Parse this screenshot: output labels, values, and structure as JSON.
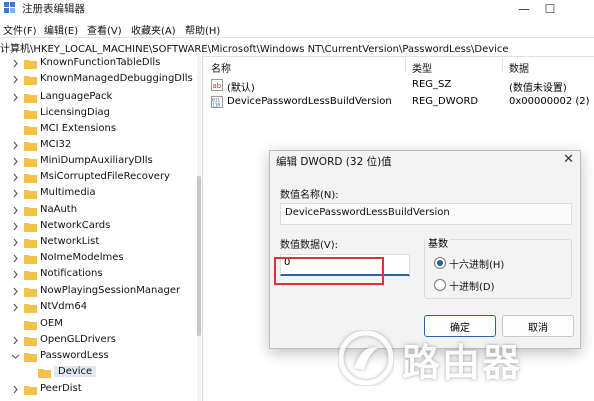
{
  "window": {
    "title": "注册表编辑器",
    "controls": {
      "minimize": "—",
      "maximize": "☐"
    }
  },
  "menu": [
    "文件(F)",
    "编辑(E)",
    "查看(V)",
    "收藏夹(A)",
    "帮助(H)"
  ],
  "address": "计算机\\HKEY_LOCAL_MACHINE\\SOFTWARE\\Microsoft\\Windows NT\\CurrentVersion\\PasswordLess\\Device",
  "tree": {
    "items": [
      {
        "label": "KnownFunctionTableDlls",
        "expanded": false
      },
      {
        "label": "KnownManagedDebuggingDlls",
        "expanded": false
      },
      {
        "label": "LanguagePack",
        "expanded": false
      },
      {
        "label": "LicensingDiag",
        "expanded": false
      },
      {
        "label": "MCI Extensions",
        "expanded": false
      },
      {
        "label": "MCI32",
        "expanded": false
      },
      {
        "label": "MiniDumpAuxiliaryDlls",
        "expanded": false
      },
      {
        "label": "MsiCorruptedFileRecovery",
        "expanded": false
      },
      {
        "label": "Multimedia",
        "expanded": false
      },
      {
        "label": "NaAuth",
        "expanded": false
      },
      {
        "label": "NetworkCards",
        "expanded": false
      },
      {
        "label": "NetworkList",
        "expanded": false
      },
      {
        "label": "NoImeModelmes",
        "expanded": false
      },
      {
        "label": "Notifications",
        "expanded": false
      },
      {
        "label": "NowPlayingSessionManager",
        "expanded": false
      },
      {
        "label": "NtVdm64",
        "expanded": false
      },
      {
        "label": "OEM",
        "expanded": false
      },
      {
        "label": "OpenGLDrivers",
        "expanded": false
      },
      {
        "label": "PasswordLess",
        "expanded": true
      },
      {
        "label": "Device",
        "child": true,
        "selected": true
      },
      {
        "label": "PeerDist",
        "expanded": false
      }
    ]
  },
  "values_pane": {
    "columns": {
      "name": "名称",
      "type": "类型",
      "data": "数据"
    },
    "rows": [
      {
        "icon": "string-value-icon",
        "name": "(默认)",
        "type": "REG_SZ",
        "data": "(数值未设置)"
      },
      {
        "icon": "binary-value-icon",
        "name": "DevicePasswordLessBuildVersion",
        "type": "REG_DWORD",
        "data": "0x00000002 (2)"
      }
    ]
  },
  "dialog": {
    "title": "编辑 DWORD (32 位)值",
    "name_label": "数值名称(N):",
    "name_value": "DevicePasswordLessBuildVersion",
    "data_label": "数值数据(V):",
    "data_value": "0",
    "base_label": "基数",
    "base_options": [
      "十六进制(H)",
      "十进制(D)"
    ],
    "base_selected": "十六进制(H)",
    "ok_label": "确定",
    "cancel_label": "取消",
    "close": "✕"
  },
  "watermark": {
    "text": "路由器"
  },
  "colors": {
    "folder": "#f2c14e",
    "accent": "#2a64a8",
    "highlight": "#e0303a"
  }
}
